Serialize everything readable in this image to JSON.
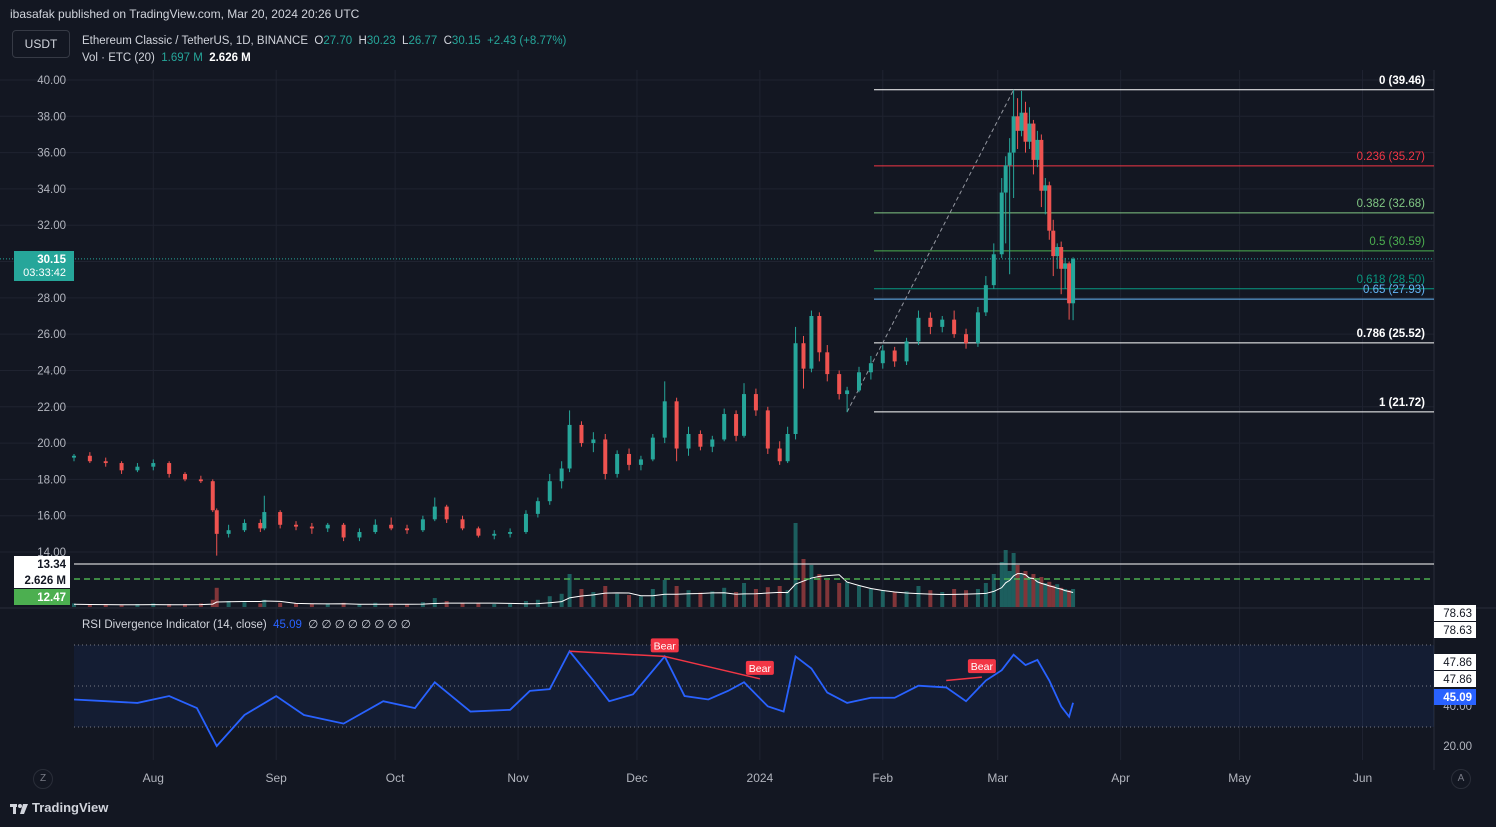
{
  "header": {
    "text": "ibasafak published on TradingView.com, Mar 20, 2024 20:26 UTC"
  },
  "currency_button": "USDT",
  "legend": {
    "symbol": "Ethereum Classic / TetherUS, 1D, BINANCE",
    "o_label": "O",
    "o": "27.70",
    "h_label": "H",
    "h": "30.23",
    "l_label": "L",
    "l": "26.77",
    "c_label": "C",
    "c": "30.15",
    "change": "+2.43 (+8.77%)",
    "vol_label": "Vol · ETC (20)",
    "vol_a": "1.697 M",
    "vol_b": "2.626 M"
  },
  "price_axis": {
    "ticks": [
      "40.00",
      "38.00",
      "36.00",
      "34.00",
      "32.00",
      "30.00",
      "28.00",
      "26.00",
      "24.00",
      "22.00",
      "20.00",
      "18.00",
      "16.00",
      "14.00"
    ],
    "last_price": "30.15",
    "countdown": "03:33:42",
    "vol_tag_1": "13.34",
    "vol_tag_2": "2.626 M",
    "vol_tag_3": "12.47"
  },
  "fib_levels": [
    {
      "label": "0 (39.46)",
      "value": 39.46,
      "color": "#ffffff"
    },
    {
      "label": "0.236 (35.27)",
      "value": 35.27,
      "color": "#f23645"
    },
    {
      "label": "0.382 (32.68)",
      "value": 32.68,
      "color": "#81c784"
    },
    {
      "label": "0.5 (30.59)",
      "value": 30.59,
      "color": "#4caf50"
    },
    {
      "label": "0.618 (28.50)",
      "value": 28.5,
      "color": "#089981"
    },
    {
      "label": "0.65 (27.93)",
      "value": 27.93,
      "color": "#64b5f6"
    },
    {
      "label": "0.786 (25.52)",
      "value": 25.52,
      "color": "#ffffff"
    },
    {
      "label": "1 (21.72)",
      "value": 21.72,
      "color": "#ffffff"
    }
  ],
  "rsi": {
    "title": "RSI Divergence Indicator (14, close)",
    "value": "45.09",
    "placeholders": "∅ ∅ ∅ ∅ ∅ ∅ ∅ ∅",
    "axis_ticks": [
      "78.63",
      "78.63",
      "47.86",
      "47.86",
      "40.00",
      "20.00"
    ],
    "bear_label": "Bear",
    "bear_signals": 3
  },
  "time_axis": {
    "labels": [
      "Aug",
      "Sep",
      "Oct",
      "Nov",
      "Dec",
      "2024",
      "Feb",
      "Mar",
      "Apr",
      "May",
      "Jun"
    ],
    "left_button": "Z",
    "right_button": "A"
  },
  "footer": {
    "brand": "TradingView"
  },
  "colors": {
    "up": "#26a69a",
    "down": "#ef5350",
    "rsi_line": "#2962ff",
    "background": "#131722",
    "grid": "#1f2330"
  },
  "chart_data": {
    "type": "candlestick",
    "title": "Ethereum Classic / TetherUS, 1D, BINANCE",
    "ylim": [
      13.34,
      40.8
    ],
    "rsi_ylim": [
      15,
      85
    ],
    "candles": [
      {
        "date": "2023-07-12",
        "o": 19.2,
        "h": 19.4,
        "l": 19.0,
        "c": 19.3
      },
      {
        "date": "2023-07-16",
        "o": 19.3,
        "h": 19.5,
        "l": 18.9,
        "c": 19.0
      },
      {
        "date": "2023-07-20",
        "o": 19.0,
        "h": 19.2,
        "l": 18.7,
        "c": 18.9
      },
      {
        "date": "2023-07-24",
        "o": 18.9,
        "h": 19.0,
        "l": 18.3,
        "c": 18.5
      },
      {
        "date": "2023-07-28",
        "o": 18.5,
        "h": 18.9,
        "l": 18.4,
        "c": 18.7
      },
      {
        "date": "2023-08-01",
        "o": 18.7,
        "h": 19.1,
        "l": 18.5,
        "c": 18.9
      },
      {
        "date": "2023-08-05",
        "o": 18.9,
        "h": 19.0,
        "l": 18.1,
        "c": 18.3
      },
      {
        "date": "2023-08-09",
        "o": 18.3,
        "h": 18.4,
        "l": 17.9,
        "c": 18.0
      },
      {
        "date": "2023-08-13",
        "o": 18.0,
        "h": 18.2,
        "l": 17.8,
        "c": 17.9
      },
      {
        "date": "2023-08-16",
        "o": 17.9,
        "h": 18.0,
        "l": 16.2,
        "c": 16.3
      },
      {
        "date": "2023-08-17",
        "o": 16.3,
        "h": 16.4,
        "l": 13.8,
        "c": 15.0
      },
      {
        "date": "2023-08-20",
        "o": 15.0,
        "h": 15.5,
        "l": 14.8,
        "c": 15.2
      },
      {
        "date": "2023-08-24",
        "o": 15.2,
        "h": 15.8,
        "l": 15.1,
        "c": 15.6
      },
      {
        "date": "2023-08-28",
        "o": 15.6,
        "h": 15.8,
        "l": 15.1,
        "c": 15.3
      },
      {
        "date": "2023-08-29",
        "o": 15.3,
        "h": 17.1,
        "l": 15.2,
        "c": 16.2
      },
      {
        "date": "2023-09-02",
        "o": 16.2,
        "h": 16.3,
        "l": 15.3,
        "c": 15.5
      },
      {
        "date": "2023-09-06",
        "o": 15.5,
        "h": 15.7,
        "l": 15.2,
        "c": 15.4
      },
      {
        "date": "2023-09-10",
        "o": 15.4,
        "h": 15.6,
        "l": 15.0,
        "c": 15.3
      },
      {
        "date": "2023-09-14",
        "o": 15.3,
        "h": 15.6,
        "l": 15.1,
        "c": 15.5
      },
      {
        "date": "2023-09-18",
        "o": 15.5,
        "h": 15.6,
        "l": 14.6,
        "c": 14.8
      },
      {
        "date": "2023-09-22",
        "o": 14.8,
        "h": 15.3,
        "l": 14.6,
        "c": 15.1
      },
      {
        "date": "2023-09-26",
        "o": 15.1,
        "h": 15.8,
        "l": 15.0,
        "c": 15.5
      },
      {
        "date": "2023-09-30",
        "o": 15.5,
        "h": 15.9,
        "l": 15.2,
        "c": 15.3
      },
      {
        "date": "2023-10-04",
        "o": 15.3,
        "h": 15.5,
        "l": 15.0,
        "c": 15.2
      },
      {
        "date": "2023-10-08",
        "o": 15.2,
        "h": 16.0,
        "l": 15.1,
        "c": 15.8
      },
      {
        "date": "2023-10-11",
        "o": 15.8,
        "h": 17.0,
        "l": 15.7,
        "c": 16.5
      },
      {
        "date": "2023-10-14",
        "o": 16.5,
        "h": 16.6,
        "l": 15.6,
        "c": 15.8
      },
      {
        "date": "2023-10-18",
        "o": 15.8,
        "h": 16.0,
        "l": 15.2,
        "c": 15.3
      },
      {
        "date": "2023-10-22",
        "o": 15.3,
        "h": 15.4,
        "l": 14.8,
        "c": 14.9
      },
      {
        "date": "2023-10-26",
        "o": 14.9,
        "h": 15.2,
        "l": 14.7,
        "c": 15.0
      },
      {
        "date": "2023-10-30",
        "o": 15.0,
        "h": 15.3,
        "l": 14.8,
        "c": 15.1
      },
      {
        "date": "2023-11-03",
        "o": 15.1,
        "h": 16.3,
        "l": 15.0,
        "c": 16.1
      },
      {
        "date": "2023-11-06",
        "o": 16.1,
        "h": 17.0,
        "l": 15.9,
        "c": 16.8
      },
      {
        "date": "2023-11-09",
        "o": 16.8,
        "h": 18.3,
        "l": 16.6,
        "c": 17.9
      },
      {
        "date": "2023-11-12",
        "o": 17.9,
        "h": 19.0,
        "l": 17.5,
        "c": 18.6
      },
      {
        "date": "2023-11-14",
        "o": 18.6,
        "h": 21.8,
        "l": 18.4,
        "c": 21.0
      },
      {
        "date": "2023-11-17",
        "o": 21.0,
        "h": 21.2,
        "l": 19.8,
        "c": 20.0
      },
      {
        "date": "2023-11-20",
        "o": 20.0,
        "h": 20.6,
        "l": 19.5,
        "c": 20.2
      },
      {
        "date": "2023-11-23",
        "o": 20.2,
        "h": 20.5,
        "l": 18.0,
        "c": 18.3
      },
      {
        "date": "2023-11-26",
        "o": 18.3,
        "h": 19.6,
        "l": 18.1,
        "c": 19.4
      },
      {
        "date": "2023-11-29",
        "o": 19.4,
        "h": 19.7,
        "l": 18.5,
        "c": 18.8
      },
      {
        "date": "2023-12-02",
        "o": 18.8,
        "h": 19.3,
        "l": 18.5,
        "c": 19.1
      },
      {
        "date": "2023-12-05",
        "o": 19.1,
        "h": 20.5,
        "l": 19.0,
        "c": 20.3
      },
      {
        "date": "2023-12-08",
        "o": 20.3,
        "h": 23.4,
        "l": 20.0,
        "c": 22.3
      },
      {
        "date": "2023-12-11",
        "o": 22.3,
        "h": 22.5,
        "l": 19.0,
        "c": 19.7
      },
      {
        "date": "2023-12-14",
        "o": 19.7,
        "h": 20.9,
        "l": 19.3,
        "c": 20.5
      },
      {
        "date": "2023-12-17",
        "o": 20.5,
        "h": 20.7,
        "l": 19.6,
        "c": 19.8
      },
      {
        "date": "2023-12-20",
        "o": 19.8,
        "h": 20.4,
        "l": 19.5,
        "c": 20.2
      },
      {
        "date": "2023-12-23",
        "o": 20.2,
        "h": 21.9,
        "l": 20.1,
        "c": 21.6
      },
      {
        "date": "2023-12-26",
        "o": 21.6,
        "h": 21.8,
        "l": 20.1,
        "c": 20.4
      },
      {
        "date": "2023-12-28",
        "o": 20.4,
        "h": 23.3,
        "l": 20.3,
        "c": 22.7
      },
      {
        "date": "2023-12-31",
        "o": 22.7,
        "h": 23.0,
        "l": 21.5,
        "c": 21.8
      },
      {
        "date": "2024-01-03",
        "o": 21.8,
        "h": 22.0,
        "l": 19.4,
        "c": 19.7
      },
      {
        "date": "2024-01-06",
        "o": 19.7,
        "h": 20.1,
        "l": 18.8,
        "c": 19.0
      },
      {
        "date": "2024-01-08",
        "o": 19.0,
        "h": 20.9,
        "l": 18.9,
        "c": 20.5
      },
      {
        "date": "2024-01-10",
        "o": 20.5,
        "h": 26.4,
        "l": 20.2,
        "c": 25.5
      },
      {
        "date": "2024-01-12",
        "o": 25.5,
        "h": 25.9,
        "l": 23.0,
        "c": 24.1
      },
      {
        "date": "2024-01-14",
        "o": 24.1,
        "h": 27.3,
        "l": 23.9,
        "c": 27.0
      },
      {
        "date": "2024-01-16",
        "o": 27.0,
        "h": 27.2,
        "l": 24.5,
        "c": 25.0
      },
      {
        "date": "2024-01-18",
        "o": 25.0,
        "h": 25.4,
        "l": 23.4,
        "c": 23.8
      },
      {
        "date": "2024-01-21",
        "o": 23.8,
        "h": 24.0,
        "l": 22.4,
        "c": 22.7
      },
      {
        "date": "2024-01-23",
        "o": 22.7,
        "h": 23.1,
        "l": 21.7,
        "c": 22.9
      },
      {
        "date": "2024-01-26",
        "o": 22.9,
        "h": 24.2,
        "l": 22.8,
        "c": 23.9
      },
      {
        "date": "2024-01-29",
        "o": 23.9,
        "h": 24.8,
        "l": 23.5,
        "c": 24.4
      },
      {
        "date": "2024-02-01",
        "o": 24.4,
        "h": 25.4,
        "l": 24.1,
        "c": 25.1
      },
      {
        "date": "2024-02-04",
        "o": 25.1,
        "h": 25.3,
        "l": 24.2,
        "c": 24.5
      },
      {
        "date": "2024-02-07",
        "o": 24.5,
        "h": 25.8,
        "l": 24.3,
        "c": 25.6
      },
      {
        "date": "2024-02-10",
        "o": 25.6,
        "h": 27.3,
        "l": 25.4,
        "c": 26.9
      },
      {
        "date": "2024-02-13",
        "o": 26.9,
        "h": 27.2,
        "l": 26.0,
        "c": 26.4
      },
      {
        "date": "2024-02-16",
        "o": 26.4,
        "h": 27.0,
        "l": 26.1,
        "c": 26.8
      },
      {
        "date": "2024-02-19",
        "o": 26.8,
        "h": 27.3,
        "l": 25.8,
        "c": 26.0
      },
      {
        "date": "2024-02-22",
        "o": 26.0,
        "h": 26.3,
        "l": 25.2,
        "c": 25.5
      },
      {
        "date": "2024-02-25",
        "o": 25.5,
        "h": 27.5,
        "l": 25.3,
        "c": 27.2
      },
      {
        "date": "2024-02-27",
        "o": 27.2,
        "h": 29.2,
        "l": 27.0,
        "c": 28.7
      },
      {
        "date": "2024-02-29",
        "o": 28.7,
        "h": 31.0,
        "l": 28.5,
        "c": 30.4
      },
      {
        "date": "2024-03-02",
        "o": 30.4,
        "h": 34.6,
        "l": 30.2,
        "c": 33.8
      },
      {
        "date": "2024-03-03",
        "o": 33.8,
        "h": 35.8,
        "l": 31.0,
        "c": 35.3
      },
      {
        "date": "2024-03-04",
        "o": 35.3,
        "h": 36.8,
        "l": 29.3,
        "c": 36.0
      },
      {
        "date": "2024-03-05",
        "o": 36.0,
        "h": 39.46,
        "l": 33.5,
        "c": 38.0
      },
      {
        "date": "2024-03-06",
        "o": 38.0,
        "h": 39.0,
        "l": 36.2,
        "c": 37.2
      },
      {
        "date": "2024-03-07",
        "o": 37.2,
        "h": 39.4,
        "l": 36.9,
        "c": 38.2
      },
      {
        "date": "2024-03-08",
        "o": 38.2,
        "h": 38.8,
        "l": 36.0,
        "c": 36.6
      },
      {
        "date": "2024-03-09",
        "o": 36.6,
        "h": 38.5,
        "l": 36.2,
        "c": 37.6
      },
      {
        "date": "2024-03-10",
        "o": 37.6,
        "h": 37.8,
        "l": 34.8,
        "c": 35.6
      },
      {
        "date": "2024-03-11",
        "o": 35.6,
        "h": 37.2,
        "l": 35.2,
        "c": 36.7
      },
      {
        "date": "2024-03-12",
        "o": 36.7,
        "h": 37.0,
        "l": 33.0,
        "c": 33.9
      },
      {
        "date": "2024-03-13",
        "o": 33.9,
        "h": 34.6,
        "l": 32.6,
        "c": 34.2
      },
      {
        "date": "2024-03-14",
        "o": 34.2,
        "h": 34.4,
        "l": 31.2,
        "c": 31.7
      },
      {
        "date": "2024-03-15",
        "o": 31.7,
        "h": 32.3,
        "l": 29.2,
        "c": 30.3
      },
      {
        "date": "2024-03-16",
        "o": 30.3,
        "h": 31.0,
        "l": 29.6,
        "c": 30.8
      },
      {
        "date": "2024-03-17",
        "o": 30.8,
        "h": 31.1,
        "l": 28.2,
        "c": 29.6
      },
      {
        "date": "2024-03-18",
        "o": 29.6,
        "h": 30.2,
        "l": 28.5,
        "c": 29.9
      },
      {
        "date": "2024-03-19",
        "o": 29.9,
        "h": 30.0,
        "l": 26.8,
        "c": 27.7
      },
      {
        "date": "2024-03-20",
        "o": 27.7,
        "h": 30.23,
        "l": 26.77,
        "c": 30.15
      }
    ],
    "rsi_series": [
      {
        "date": "2023-07-12",
        "v": 47
      },
      {
        "date": "2023-07-20",
        "v": 46
      },
      {
        "date": "2023-07-28",
        "v": 45
      },
      {
        "date": "2023-08-05",
        "v": 49
      },
      {
        "date": "2023-08-12",
        "v": 42
      },
      {
        "date": "2023-08-17",
        "v": 20
      },
      {
        "date": "2023-08-24",
        "v": 38
      },
      {
        "date": "2023-09-01",
        "v": 49
      },
      {
        "date": "2023-09-08",
        "v": 38
      },
      {
        "date": "2023-09-18",
        "v": 33
      },
      {
        "date": "2023-09-28",
        "v": 46
      },
      {
        "date": "2023-10-06",
        "v": 42
      },
      {
        "date": "2023-10-11",
        "v": 57
      },
      {
        "date": "2023-10-20",
        "v": 40
      },
      {
        "date": "2023-10-30",
        "v": 41
      },
      {
        "date": "2023-11-04",
        "v": 52
      },
      {
        "date": "2023-11-09",
        "v": 53
      },
      {
        "date": "2023-11-14",
        "v": 75
      },
      {
        "date": "2023-11-20",
        "v": 58
      },
      {
        "date": "2023-11-24",
        "v": 46
      },
      {
        "date": "2023-11-30",
        "v": 50
      },
      {
        "date": "2023-12-08",
        "v": 72
      },
      {
        "date": "2023-12-13",
        "v": 49
      },
      {
        "date": "2023-12-19",
        "v": 47
      },
      {
        "date": "2023-12-24",
        "v": 52
      },
      {
        "date": "2023-12-28",
        "v": 57
      },
      {
        "date": "2024-01-03",
        "v": 43
      },
      {
        "date": "2024-01-07",
        "v": 40
      },
      {
        "date": "2024-01-10",
        "v": 72
      },
      {
        "date": "2024-01-14",
        "v": 65
      },
      {
        "date": "2024-01-18",
        "v": 51
      },
      {
        "date": "2024-01-23",
        "v": 45
      },
      {
        "date": "2024-01-29",
        "v": 48
      },
      {
        "date": "2024-02-04",
        "v": 48
      },
      {
        "date": "2024-02-10",
        "v": 55
      },
      {
        "date": "2024-02-17",
        "v": 54
      },
      {
        "date": "2024-02-22",
        "v": 46
      },
      {
        "date": "2024-02-27",
        "v": 58
      },
      {
        "date": "2024-03-02",
        "v": 64
      },
      {
        "date": "2024-03-05",
        "v": 73
      },
      {
        "date": "2024-03-08",
        "v": 67
      },
      {
        "date": "2024-03-11",
        "v": 70
      },
      {
        "date": "2024-03-14",
        "v": 58
      },
      {
        "date": "2024-03-17",
        "v": 43
      },
      {
        "date": "2024-03-19",
        "v": 37
      },
      {
        "date": "2024-03-20",
        "v": 45.09
      }
    ],
    "volume_relative": [
      0.06,
      0.05,
      0.05,
      0.04,
      0.05,
      0.06,
      0.05,
      0.05,
      0.06,
      0.12,
      0.32,
      0.1,
      0.08,
      0.06,
      0.12,
      0.07,
      0.06,
      0.05,
      0.06,
      0.07,
      0.05,
      0.07,
      0.06,
      0.05,
      0.08,
      0.15,
      0.1,
      0.07,
      0.06,
      0.05,
      0.05,
      0.1,
      0.12,
      0.18,
      0.22,
      0.55,
      0.3,
      0.25,
      0.35,
      0.22,
      0.2,
      0.18,
      0.3,
      0.45,
      0.35,
      0.28,
      0.24,
      0.26,
      0.32,
      0.25,
      0.4,
      0.3,
      0.33,
      0.35,
      0.28,
      1.4,
      0.8,
      0.7,
      0.55,
      0.45,
      0.4,
      0.42,
      0.35,
      0.3,
      0.28,
      0.25,
      0.26,
      0.35,
      0.28,
      0.25,
      0.3,
      0.28,
      0.3,
      0.4,
      0.55,
      0.75,
      0.95,
      0.6,
      0.9,
      0.7,
      0.55,
      0.6,
      0.5,
      0.55,
      0.45,
      0.5,
      0.4,
      0.42,
      0.36,
      0.38,
      0.32,
      0.3,
      0.28,
      0.3
    ]
  }
}
